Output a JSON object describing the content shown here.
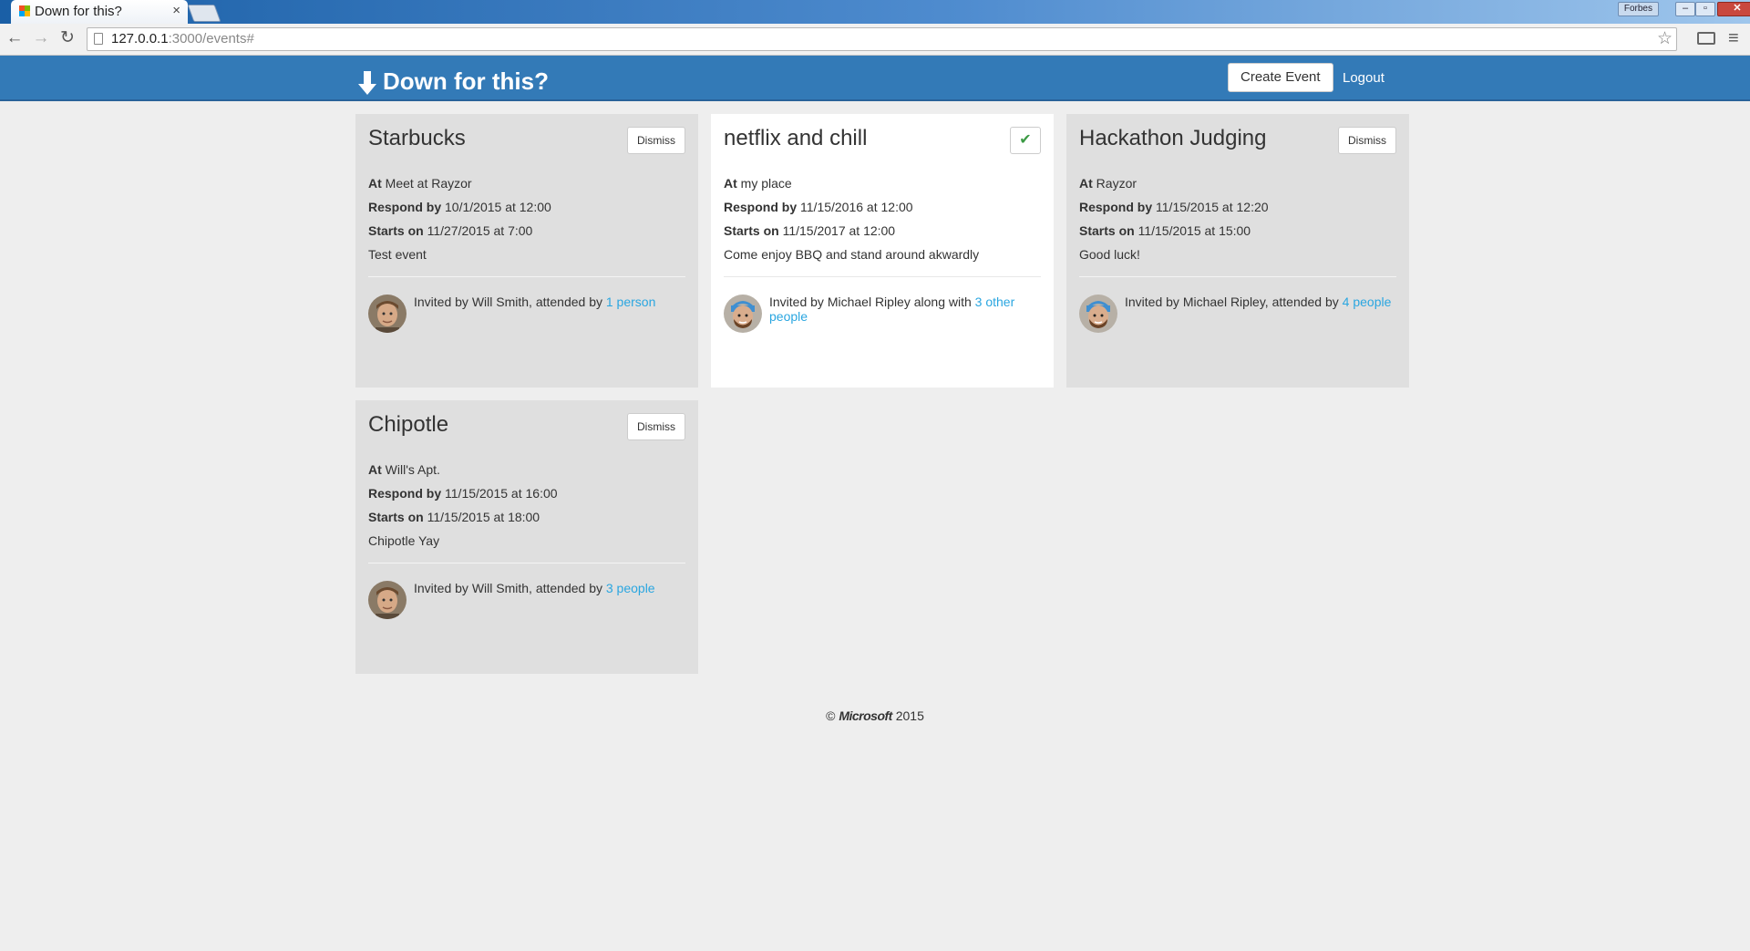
{
  "browser": {
    "tab_title": "Down for this?",
    "tab_close": "×",
    "user_badge": "Forbes",
    "url_host": "127.0.0.1",
    "url_path": ":3000/events#",
    "star": "☆",
    "back": "←",
    "forward": "→",
    "reload": "↻",
    "menu": "≡",
    "win_min": "–",
    "win_max": "▫",
    "win_close": "✕"
  },
  "navbar": {
    "brand": "Down for this?",
    "create_event": "Create Event",
    "logout": "Logout"
  },
  "labels": {
    "at": "At",
    "respond_by": "Respond by",
    "starts_on": "Starts on",
    "dismiss": "Dismiss",
    "check": "✔"
  },
  "events": [
    {
      "title": "Starbucks",
      "location": "Meet at Rayzor",
      "respond_by": "10/1/2015 at 12:00",
      "starts_on": "11/27/2015 at 7:00",
      "description": "Test event",
      "invite_text": "Invited by Will Smith, attended by ",
      "invite_link": "1 person",
      "status": "dismissable",
      "avatar": "will-smith"
    },
    {
      "title": "netflix and chill",
      "location": "my place",
      "respond_by": "11/15/2016 at 12:00",
      "starts_on": "11/15/2017 at 12:00",
      "description": "Come enjoy BBQ and stand around akwardly",
      "invite_text": "Invited by Michael Ripley along with ",
      "invite_link": "3 other people",
      "status": "accepted",
      "avatar": "michael-ripley"
    },
    {
      "title": "Hackathon Judging",
      "location": "Rayzor",
      "respond_by": "11/15/2015 at 12:20",
      "starts_on": "11/15/2015 at 15:00",
      "description": "Good luck!",
      "invite_text": "Invited by Michael Ripley, attended by ",
      "invite_link": "4 people",
      "status": "dismissable",
      "avatar": "michael-ripley"
    },
    {
      "title": "Chipotle",
      "location": "Will's Apt.",
      "respond_by": "11/15/2015 at 16:00",
      "starts_on": "11/15/2015 at 18:00",
      "description": "Chipotle Yay",
      "invite_text": "Invited by Will Smith, attended by ",
      "invite_link": "3 people",
      "status": "dismissable",
      "avatar": "will-smith"
    }
  ],
  "footer": {
    "copyright": "©",
    "company": "Microsoft",
    "year": "2015"
  },
  "colors": {
    "navbar": "#337ab7",
    "link": "#2aa6e0",
    "card_inactive": "#dfdfdf",
    "card_active": "#ffffff",
    "check": "#3c9a45"
  }
}
